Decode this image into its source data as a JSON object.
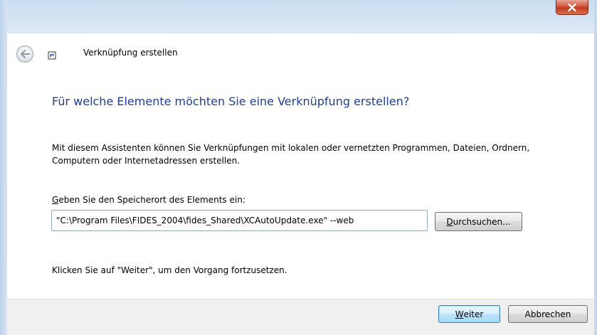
{
  "window": {
    "close_label": "X"
  },
  "header": {
    "title": "Verknüpfung erstellen"
  },
  "main": {
    "question": "Für welche Elemente möchten Sie eine Verknüpfung erstellen?",
    "description": "Mit diesem Assistenten können Sie Verknüpfungen mit lokalen oder vernetzten Programmen, Dateien, Ordnern, Computern oder Internetadressen erstellen.",
    "location_label_underlined": "G",
    "location_label_rest": "eben Sie den Speicherort des Elements ein:",
    "location_value": "\"C:\\Program Files\\FIDES_2004\\fides_Shared\\XCAutoUpdate.exe\" --web",
    "browse_underlined": "D",
    "browse_rest": "urchsuchen...",
    "hint": "Klicken Sie auf \"Weiter\", um den Vorgang fortzusetzen."
  },
  "footer": {
    "next_underlined": "W",
    "next_rest": "eiter",
    "cancel_label": "Abbrechen"
  },
  "colors": {
    "heading": "#1f3f9a",
    "close_red": "#c53b20",
    "frame": "#dbe7f4",
    "footer_bg": "#f0f0f0"
  },
  "icons": [
    "back-arrow-icon",
    "shortcut-wizard-icon",
    "close-icon"
  ]
}
